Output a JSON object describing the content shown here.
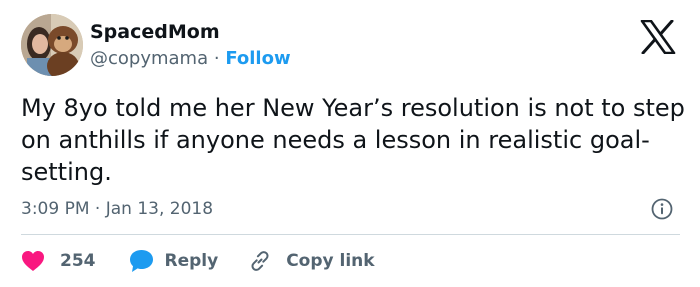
{
  "author": {
    "name": "SpacedMom",
    "handle": "@copymama",
    "separator": "·",
    "follow_label": "Follow",
    "avatar_icon": "avatar-photo"
  },
  "tweet": {
    "text": "My 8yo told me her New Year’s resolution is not to step on anthills if anyone needs a lesson in realistic goal-setting.",
    "time": "3:09 PM",
    "separator": "·",
    "date": "Jan 13, 2018"
  },
  "actions": {
    "like_count": "254",
    "reply_label": "Reply",
    "copy_link_label": "Copy link"
  },
  "colors": {
    "accent": "#1d9bf0",
    "heart": "#f91880",
    "text": "#0f1419",
    "muted": "#536471",
    "divider": "#cfd9de"
  },
  "icons": [
    "avatar-photo",
    "x-logo-icon",
    "info-icon",
    "heart-icon",
    "reply-bubble-icon",
    "link-icon"
  ]
}
